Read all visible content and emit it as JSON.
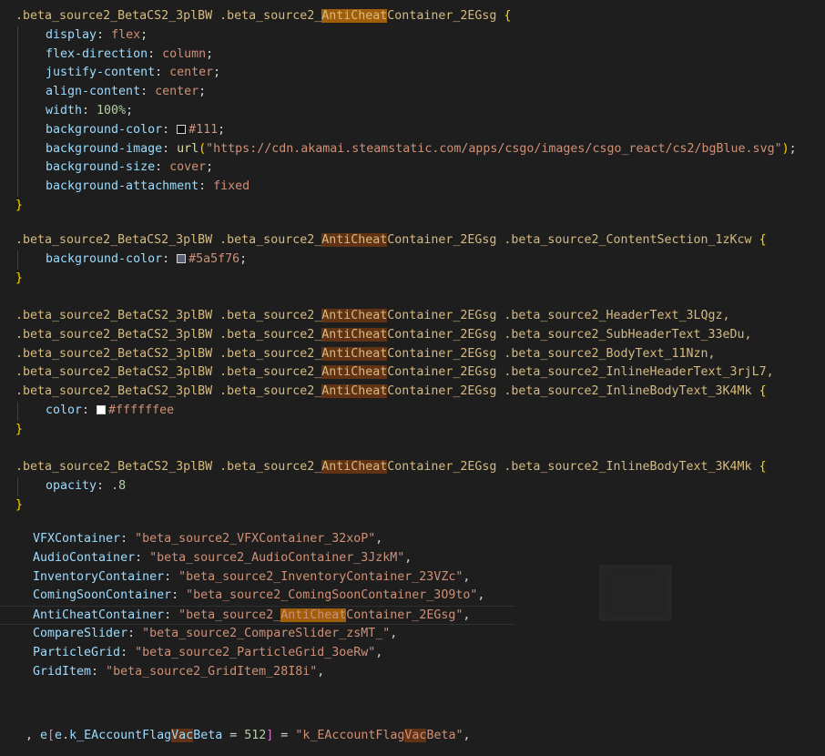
{
  "css_block1": {
    "selector_pre": ".beta_source2_BetaCS2_3plBW .beta_source2_",
    "selector_hl": "AntiCheat",
    "selector_post": "Container_2EGsg ",
    "open": "{",
    "close": "}",
    "decls": [
      {
        "prop": "display",
        "value": "flex"
      },
      {
        "prop": "flex-direction",
        "value": "column"
      },
      {
        "prop": "justify-content",
        "value": "center"
      },
      {
        "prop": "align-content",
        "value": "center"
      },
      {
        "prop": "width",
        "value": "100%"
      },
      {
        "prop": "background-color",
        "value": "#111",
        "swatch": "#111111"
      },
      {
        "prop": "background-image",
        "fn": "url",
        "url": "\"https://cdn.akamai.steamstatic.com/apps/csgo/images/csgo_react/cs2/bgBlue.svg\""
      },
      {
        "prop": "background-size",
        "value": "cover"
      },
      {
        "prop": "background-attachment",
        "value": "fixed"
      }
    ]
  },
  "css_block2": {
    "selector_pre": ".beta_source2_BetaCS2_3plBW .beta_source2_",
    "selector_hl": "AntiCheat",
    "selector_post": "Container_2EGsg .beta_source2_ContentSection_1zKcw ",
    "open": "{",
    "close": "}",
    "prop": "background-color",
    "value": "#5a5f76",
    "swatch": "#5a5f76"
  },
  "css_block3": {
    "selectors": [
      {
        "pre": ".beta_source2_BetaCS2_3plBW .beta_source2_",
        "hl": "AntiCheat",
        "post": "Container_2EGsg .beta_source2_HeaderText_3LQgz,"
      },
      {
        "pre": ".beta_source2_BetaCS2_3plBW .beta_source2_",
        "hl": "AntiCheat",
        "post": "Container_2EGsg .beta_source2_SubHeaderText_33eDu,"
      },
      {
        "pre": ".beta_source2_BetaCS2_3plBW .beta_source2_",
        "hl": "AntiCheat",
        "post": "Container_2EGsg .beta_source2_BodyText_11Nzn,"
      },
      {
        "pre": ".beta_source2_BetaCS2_3plBW .beta_source2_",
        "hl": "AntiCheat",
        "post": "Container_2EGsg .beta_source2_InlineHeaderText_3rjL7,"
      },
      {
        "pre": ".beta_source2_BetaCS2_3plBW .beta_source2_",
        "hl": "AntiCheat",
        "post": "Container_2EGsg .beta_source2_InlineBodyText_3K4Mk "
      }
    ],
    "open": "{",
    "close": "}",
    "prop": "color",
    "value": "#ffffffee",
    "swatch": "#ffffff"
  },
  "css_block4": {
    "selector_pre": ".beta_source2_BetaCS2_3plBW .beta_source2_",
    "selector_hl": "AntiCheat",
    "selector_post": "Container_2EGsg .beta_source2_InlineBodyText_3K4Mk ",
    "open": "{",
    "close": "}",
    "prop": "opacity",
    "value": ".8"
  },
  "js_map": [
    {
      "key": "VFXContainer",
      "pre": "\"beta_source2_VFXContainer_32xoP\"",
      "hl": "",
      "post": ""
    },
    {
      "key": "AudioContainer",
      "pre": "\"beta_source2_AudioContainer_3JzkM\"",
      "hl": "",
      "post": ""
    },
    {
      "key": "InventoryContainer",
      "pre": "\"beta_source2_InventoryContainer_23VZc\"",
      "hl": "",
      "post": ""
    },
    {
      "key": "ComingSoonContainer",
      "pre": "\"beta_source2_ComingSoonContainer_3O9to\"",
      "hl": "",
      "post": ""
    },
    {
      "key": "AntiCheatContainer",
      "pre": "\"beta_source2_",
      "hl": "AntiCheat",
      "post": "Container_2EGsg\""
    },
    {
      "key": "CompareSlider",
      "pre": "\"beta_source2_CompareSlider_zsMT_\"",
      "hl": "",
      "post": ""
    },
    {
      "key": "ParticleGrid",
      "pre": "\"beta_source2_ParticleGrid_3oeRw\"",
      "hl": "",
      "post": ""
    },
    {
      "key": "GridItem",
      "pre": "\"beta_source2_GridItem_28I8i\"",
      "hl": "",
      "post": ""
    }
  ],
  "enum_line": {
    "comma_prefix": ", ",
    "e1": "e",
    "e2": "e",
    "k_pre": "k_EAccountFlag",
    "k_hl": "Vac",
    "k_post": "Beta",
    "number": "512",
    "str_pre": "\"k_EAccountFlag",
    "str_hl": "Vac",
    "str_post": "Beta\""
  },
  "colors": {
    "editor_bg": "#1e1e1e",
    "selector": "#d7ba7d",
    "property": "#9cdcfe",
    "value": "#ce9178",
    "number": "#b5cea8",
    "function": "#dcdcaa",
    "brace": "#ffd700",
    "search_highlight": "#613214",
    "search_highlight_current": "#a05e0b"
  }
}
